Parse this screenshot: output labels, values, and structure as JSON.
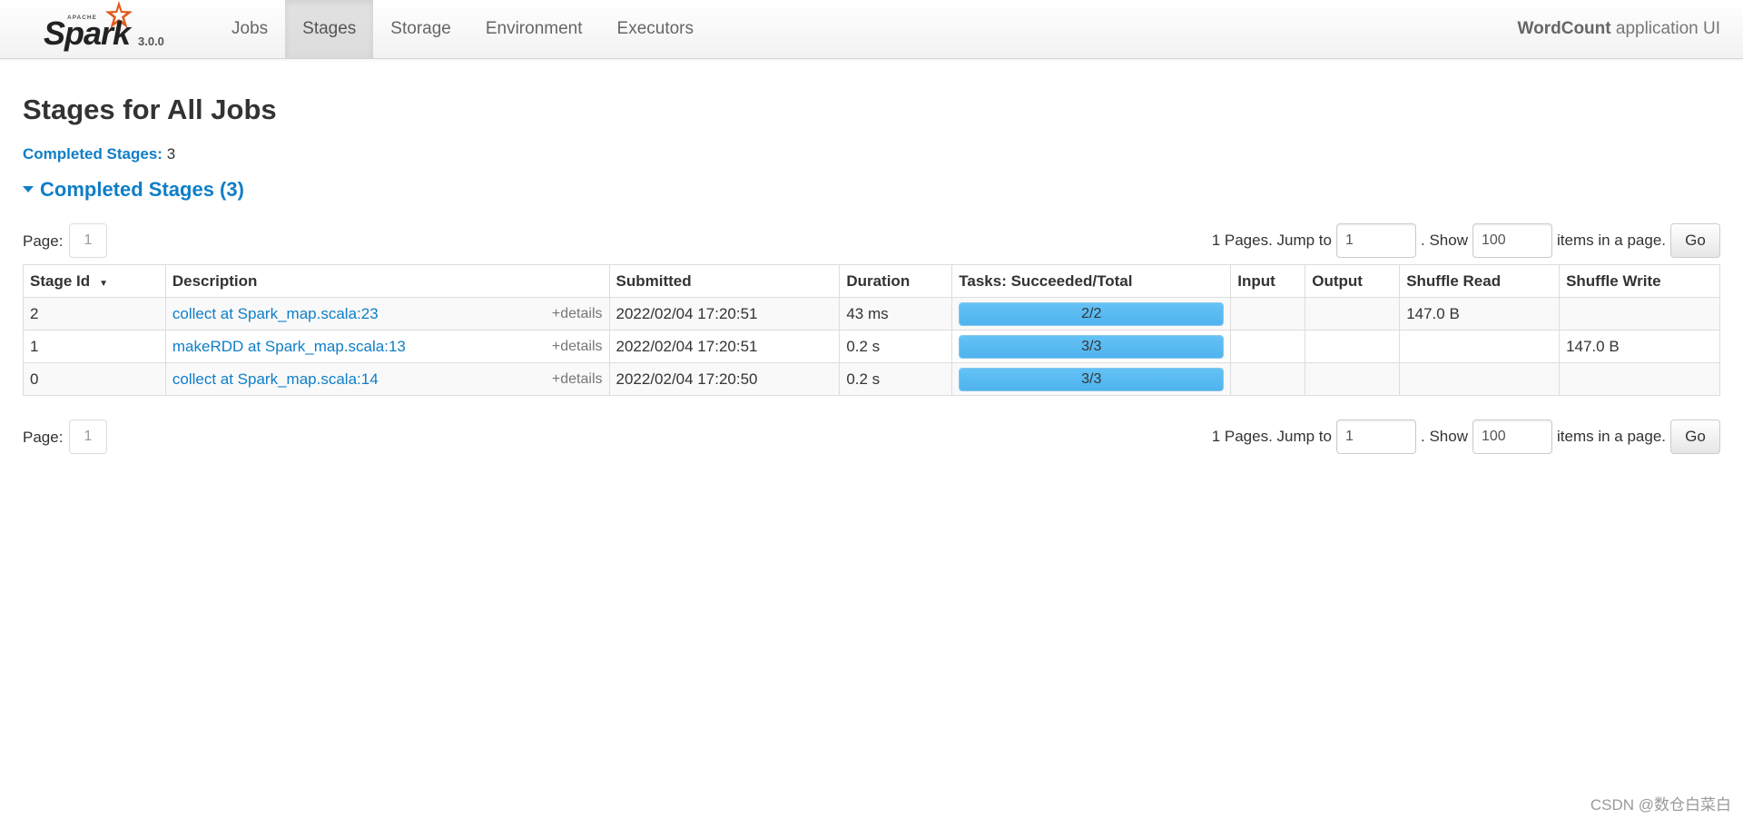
{
  "navbar": {
    "brand_apache": "APACHE",
    "brand_spark": "Spark",
    "version": "3.0.0",
    "items": [
      {
        "label": "Jobs",
        "active": false
      },
      {
        "label": "Stages",
        "active": true
      },
      {
        "label": "Storage",
        "active": false
      },
      {
        "label": "Environment",
        "active": false
      },
      {
        "label": "Executors",
        "active": false
      }
    ],
    "app_name": "WordCount",
    "app_suffix": " application UI"
  },
  "page": {
    "title": "Stages for All Jobs",
    "summary_label": "Completed Stages:",
    "summary_value": " 3",
    "section_title": "Completed Stages (3)"
  },
  "pager": {
    "page_label": "Page:",
    "current_page": "1",
    "pages_text": "1 Pages. Jump to",
    "jump_value": "1",
    "show_text": ". Show",
    "show_value": "100",
    "items_text": "items in a page.",
    "go_label": "Go"
  },
  "table": {
    "headers": {
      "stage_id": "Stage Id",
      "description": "Description",
      "submitted": "Submitted",
      "duration": "Duration",
      "tasks": "Tasks: Succeeded/Total",
      "input": "Input",
      "output": "Output",
      "shuffle_read": "Shuffle Read",
      "shuffle_write": "Shuffle Write"
    },
    "sort_indicator": "▼",
    "details_label": "+details",
    "rows": [
      {
        "stage_id": "2",
        "description": "collect at Spark_map.scala:23",
        "submitted": "2022/02/04 17:20:51",
        "duration": "43 ms",
        "tasks_text": "2/2",
        "tasks_fraction": 1.0,
        "input": "",
        "output": "",
        "shuffle_read": "147.0 B",
        "shuffle_write": ""
      },
      {
        "stage_id": "1",
        "description": "makeRDD at Spark_map.scala:13",
        "submitted": "2022/02/04 17:20:51",
        "duration": "0.2 s",
        "tasks_text": "3/3",
        "tasks_fraction": 1.0,
        "input": "",
        "output": "",
        "shuffle_read": "",
        "shuffle_write": "147.0 B"
      },
      {
        "stage_id": "0",
        "description": "collect at Spark_map.scala:14",
        "submitted": "2022/02/04 17:20:50",
        "duration": "0.2 s",
        "tasks_text": "3/3",
        "tasks_fraction": 1.0,
        "input": "",
        "output": "",
        "shuffle_read": "",
        "shuffle_write": ""
      }
    ]
  },
  "watermark": "CSDN @数仓白菜白",
  "colors": {
    "link": "#0f7ec8",
    "progress": "#4fb3ee"
  }
}
